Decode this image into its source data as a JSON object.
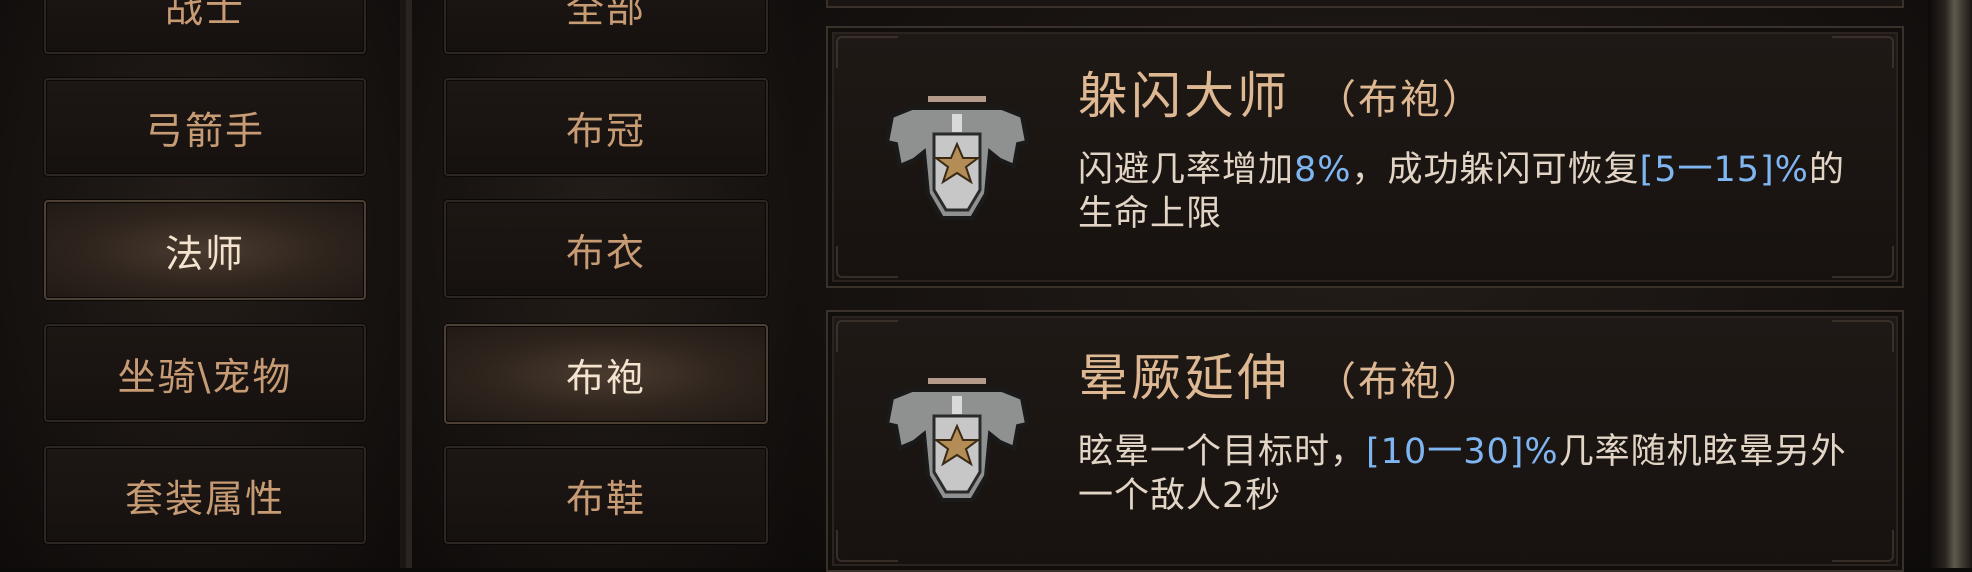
{
  "class_list": [
    {
      "label": "战士",
      "active": false
    },
    {
      "label": "弓箭手",
      "active": false
    },
    {
      "label": "法师",
      "active": true
    },
    {
      "label": "坐骑\\宠物",
      "active": false
    },
    {
      "label": "套装属性",
      "active": false
    }
  ],
  "slot_list": [
    {
      "label": "全部",
      "active": false
    },
    {
      "label": "布冠",
      "active": false
    },
    {
      "label": "布衣",
      "active": false
    },
    {
      "label": "布袍",
      "active": true
    },
    {
      "label": "布鞋",
      "active": false
    }
  ],
  "skills": [
    {
      "name": "躲闪大师",
      "tag": "（布袍）",
      "icon": "eagle-star-crest-icon",
      "desc_parts": [
        {
          "text": "闪避几率增加",
          "hl": false
        },
        {
          "text": "8%",
          "hl": true
        },
        {
          "text": "，成功躲闪可恢复",
          "hl": false
        },
        {
          "text": "[5一15]%",
          "hl": true
        },
        {
          "text": "的生命上限",
          "hl": false
        }
      ]
    },
    {
      "name": "晕厥延伸",
      "tag": "（布袍）",
      "icon": "eagle-star-crest-icon",
      "desc_parts": [
        {
          "text": "眩晕一个目标时，",
          "hl": false
        },
        {
          "text": "[10一30]%",
          "hl": true
        },
        {
          "text": "几率随机眩晕另外一个敌人2秒",
          "hl": false
        }
      ]
    }
  ],
  "colors": {
    "label": "#c79b74",
    "label_active": "#f4e4cf",
    "title": "#ddb893",
    "desc": "#e2d5c6",
    "highlight": "#7fb6f2"
  }
}
